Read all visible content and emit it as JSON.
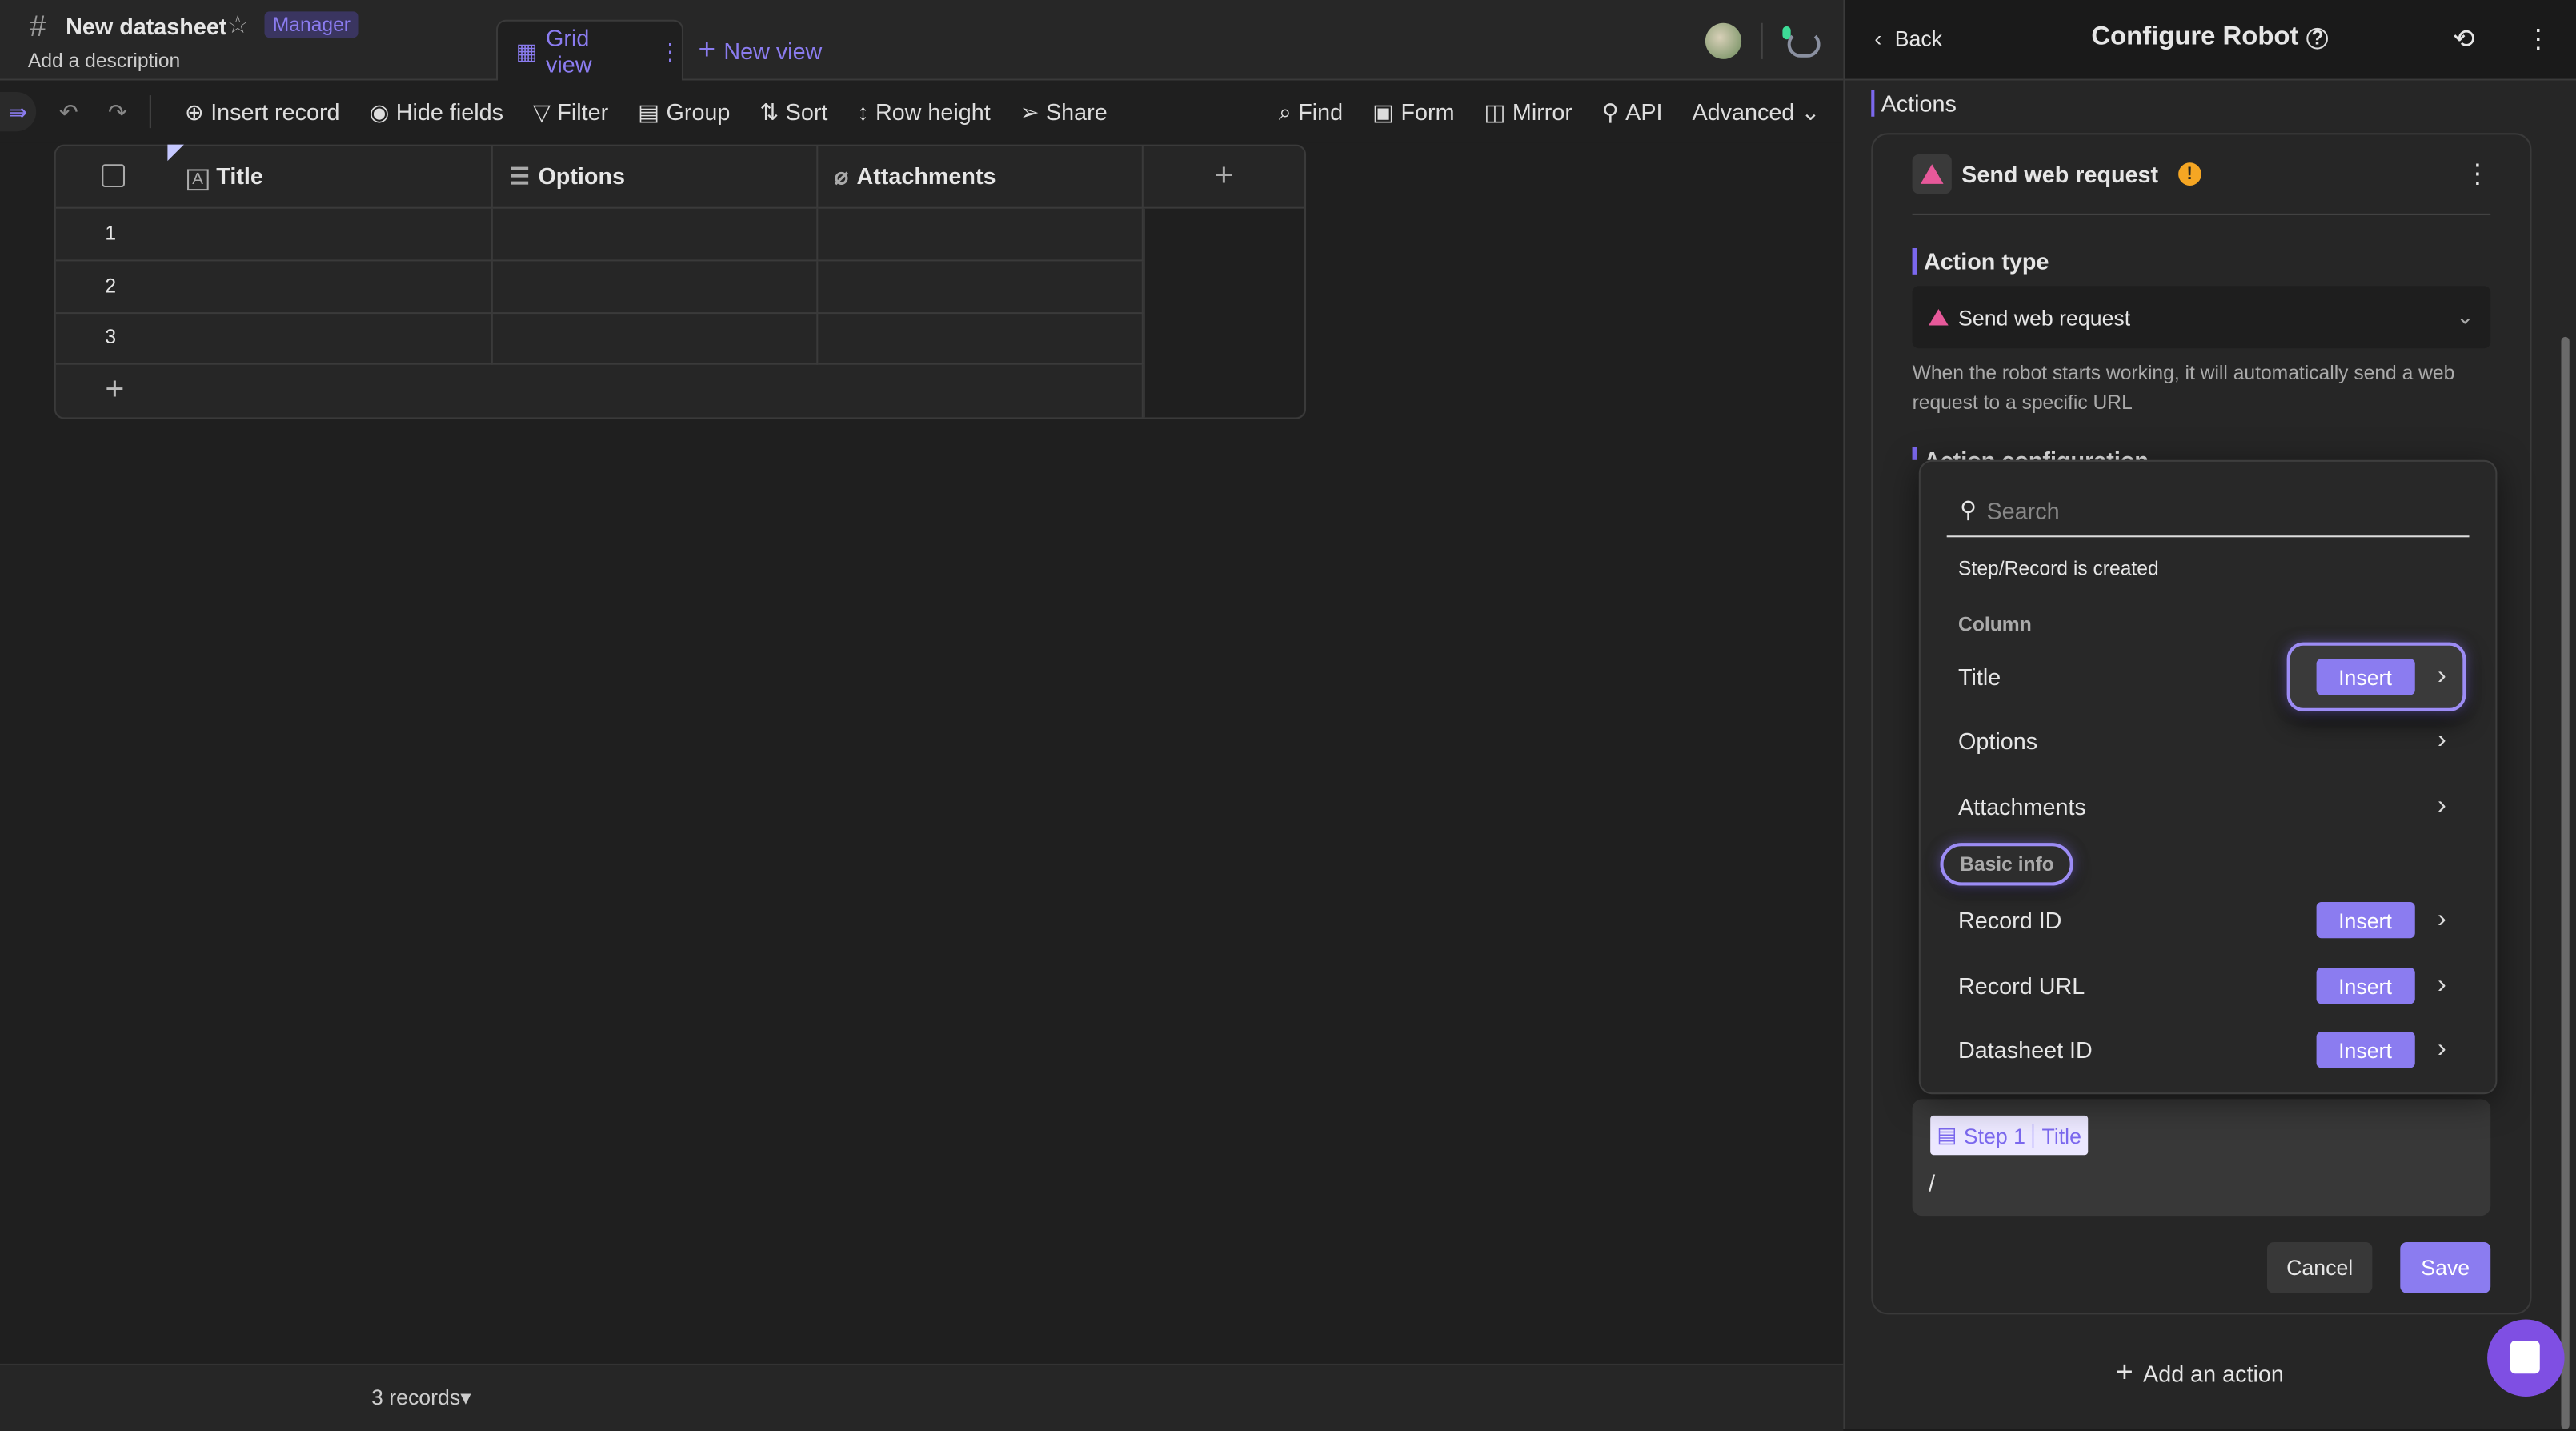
{
  "header": {
    "title": "New datasheet",
    "role_badge": "Manager",
    "description": "Add a description",
    "tabs": [
      {
        "label": "Grid view",
        "active": true
      },
      {
        "label": "New view"
      }
    ]
  },
  "toolbar": {
    "items": [
      "Insert record",
      "Hide fields",
      "Filter",
      "Group",
      "Sort",
      "Row height",
      "Share"
    ],
    "right_items": [
      "Find",
      "Form",
      "Mirror",
      "API",
      "Advanced"
    ]
  },
  "grid": {
    "columns": [
      "Title",
      "Options",
      "Attachments"
    ],
    "rows": [
      "1",
      "2",
      "3"
    ]
  },
  "footer": {
    "records": "3 records"
  },
  "panel": {
    "back": "Back",
    "title": "Configure Robot",
    "section": "Actions",
    "action_title": "Send web request",
    "action_type_label": "Action type",
    "action_type_value": "Send web request",
    "action_type_desc": "When the robot starts working, it will automatically send a web request to a specific URL",
    "action_config_label": "Action configuration",
    "token": {
      "step": "Step 1",
      "field": "Title"
    },
    "editor_text": "/",
    "cancel": "Cancel",
    "save": "Save",
    "add_action": "Add an action"
  },
  "dropdown": {
    "search_placeholder": "Search",
    "source": "Step/Record is created",
    "column_header": "Column",
    "columns": [
      {
        "label": "Title",
        "insert": "Insert"
      },
      {
        "label": "Options"
      },
      {
        "label": "Attachments"
      }
    ],
    "basic_header": "Basic info",
    "basic": [
      {
        "label": "Record ID",
        "insert": "Insert"
      },
      {
        "label": "Record URL",
        "insert": "Insert"
      },
      {
        "label": "Datasheet ID",
        "insert": "Insert"
      }
    ]
  },
  "colors": {
    "accent": "#8b7cf0",
    "warning": "#f5a623",
    "chat": "#7f4fe3"
  }
}
